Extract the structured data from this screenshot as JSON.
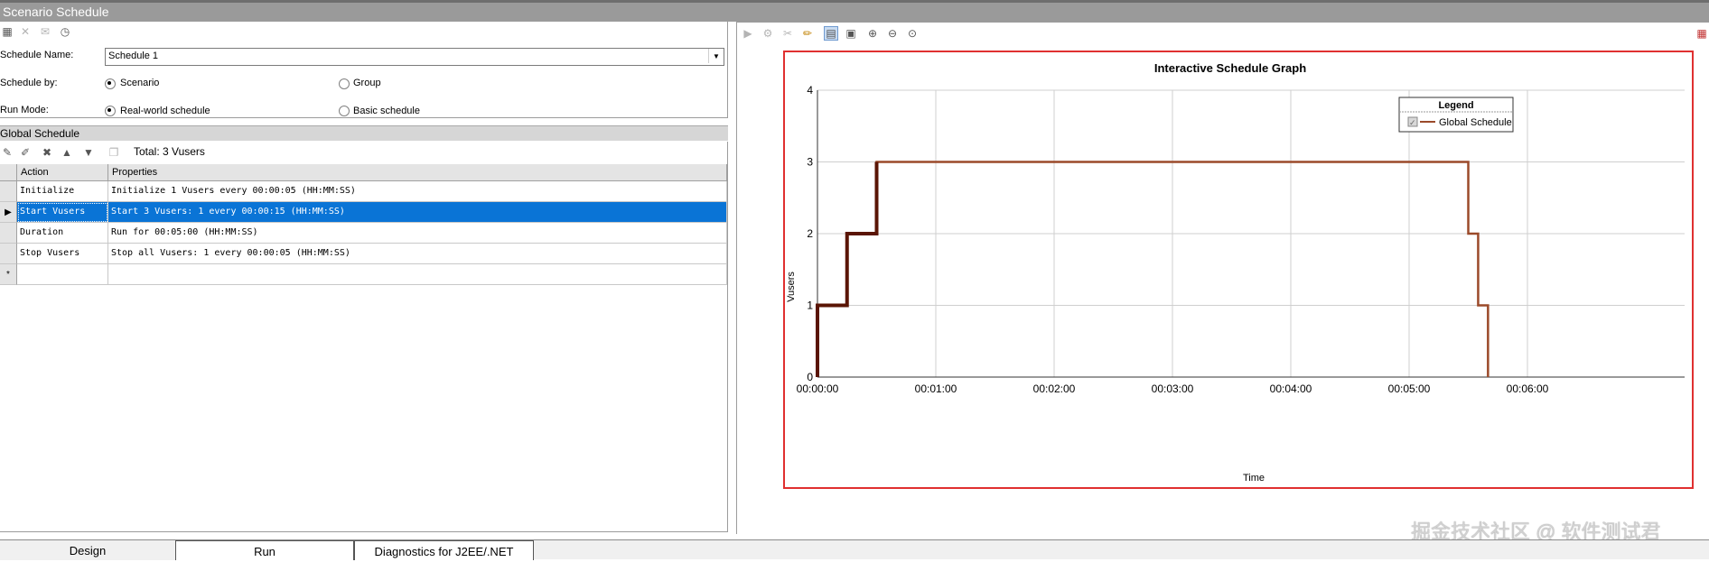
{
  "window": {
    "title": "Scenario Schedule"
  },
  "left_toolbar": {
    "icons": [
      "new-schedule-icon",
      "delete-icon",
      "rename-icon",
      "schedule-clock-icon"
    ]
  },
  "schedule_form": {
    "name_label": "Schedule Name:",
    "name_value": "Schedule 1",
    "schedule_by_label": "Schedule by:",
    "schedule_by_options": [
      "Scenario",
      "Group"
    ],
    "schedule_by_selected": "Scenario",
    "run_mode_label": "Run Mode:",
    "run_mode_options": [
      "Real-world schedule",
      "Basic schedule"
    ],
    "run_mode_selected": "Real-world schedule"
  },
  "global_schedule": {
    "title": "Global Schedule",
    "total": "Total: 3 Vusers",
    "columns": [
      "Action",
      "Properties"
    ],
    "rows": [
      {
        "action": "Initialize",
        "properties": "Initialize 1 Vusers every 00:00:05 (HH:MM:SS)",
        "selected": false
      },
      {
        "action": "Start  Vusers",
        "properties": "Start 3 Vusers: 1 every 00:00:15 (HH:MM:SS)",
        "selected": true
      },
      {
        "action": "Duration",
        "properties": "Run for 00:05:00 (HH:MM:SS)",
        "selected": false
      },
      {
        "action": "Stop Vusers",
        "properties": "Stop all Vusers: 1 every 00:00:05 (HH:MM:SS)",
        "selected": false
      }
    ],
    "new_row_marker": "*",
    "current_row_marker": "▶",
    "selection_color": "#0a74d6"
  },
  "graph_toolbar": {
    "icons": [
      "pointer-icon",
      "edit-action-icon",
      "split-icon",
      "pencil-icon",
      "view-mode-icon",
      "fit-icon",
      "zoom-in-icon",
      "zoom-out-icon",
      "zoom-reset-icon"
    ]
  },
  "chart_data": {
    "type": "line",
    "title": "Interactive Schedule Graph",
    "xlabel": "Time",
    "ylabel": "Vusers",
    "xlim_seconds": [
      0,
      360
    ],
    "ylim": [
      0,
      4
    ],
    "x_ticks": [
      "00:00:00",
      "00:01:00",
      "00:02:00",
      "00:03:00",
      "00:04:00",
      "00:05:00",
      "00:06:00"
    ],
    "y_ticks": [
      "0",
      "1",
      "2",
      "3",
      "4"
    ],
    "grid": true,
    "legend": {
      "title": "Legend",
      "placement": "top-right",
      "entries": [
        "Global Schedule"
      ]
    },
    "series": [
      {
        "name": "Global Schedule",
        "color": "#9b4a2a",
        "points_seconds": [
          [
            0,
            0
          ],
          [
            0,
            1
          ],
          [
            15,
            1
          ],
          [
            15,
            2
          ],
          [
            30,
            2
          ],
          [
            30,
            3
          ],
          [
            330,
            3
          ],
          [
            330,
            2
          ],
          [
            335,
            2
          ],
          [
            335,
            1
          ],
          [
            340,
            1
          ],
          [
            340,
            0
          ]
        ]
      }
    ],
    "highlight_color": "#5a1505",
    "highlight_until_seconds": 30
  },
  "tabs": [
    {
      "label": "Design",
      "active": true
    },
    {
      "label": "Run",
      "active": false
    },
    {
      "label": "Diagnostics for J2EE/.NET",
      "active": false
    }
  ],
  "watermark": "掘金技术社区 @ 软件测试君"
}
